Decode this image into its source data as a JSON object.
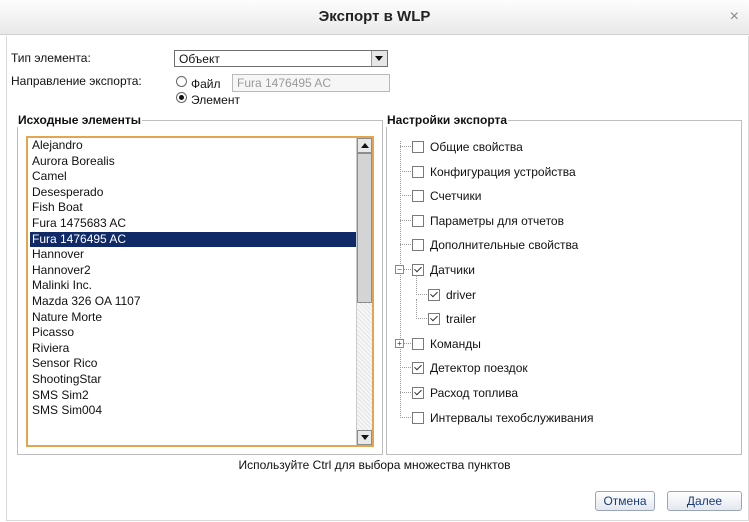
{
  "dialog": {
    "title": "Экспорт в WLP",
    "close_glyph": "×"
  },
  "form": {
    "type_label": "Тип элемента:",
    "type_value": "Объект",
    "direction_label": "Направление экспорта:",
    "direction_file_label": "Файл",
    "direction_element_label": "Элемент",
    "direction_selected": "Элемент",
    "file_field_value": "Fura 1476495 AC"
  },
  "source": {
    "legend": "Исходные элементы",
    "items": [
      "Alejandro",
      "Aurora Borealis",
      "Camel",
      "Desesperado",
      "Fish Boat",
      "Fura 1475683 AC",
      "Fura 1476495 AC",
      "Hannover",
      "Hannover2",
      "Malinki Inc.",
      "Mazda 326 OA 1107",
      "Nature Morte",
      "Picasso",
      "Riviera",
      "Sensor Rico",
      "ShootingStar",
      "SMS Sim2",
      "SMS Sim004"
    ],
    "selected_index": 6
  },
  "settings": {
    "legend": "Настройки экспорта",
    "nodes": [
      {
        "label": "Общие свойства",
        "checked": false,
        "level": 0
      },
      {
        "label": "Конфигурация устройства",
        "checked": false,
        "level": 0
      },
      {
        "label": "Счетчики",
        "checked": false,
        "level": 0
      },
      {
        "label": "Параметры для отчетов",
        "checked": false,
        "level": 0
      },
      {
        "label": "Дополнительные свойства",
        "checked": false,
        "level": 0
      },
      {
        "label": "Датчики",
        "checked": true,
        "level": 0,
        "expander": "−"
      },
      {
        "label": "driver",
        "checked": true,
        "level": 1
      },
      {
        "label": "trailer",
        "checked": true,
        "level": 1
      },
      {
        "label": "Команды",
        "checked": false,
        "level": 0,
        "expander": "+"
      },
      {
        "label": "Детектор поездок",
        "checked": true,
        "level": 0
      },
      {
        "label": "Расход топлива",
        "checked": true,
        "level": 0
      },
      {
        "label": "Интервалы техобслуживания",
        "checked": false,
        "level": 0
      }
    ]
  },
  "hint": "Используйте Ctrl для выбора множества пунктов",
  "buttons": {
    "cancel": "Отмена",
    "next": "Далее"
  },
  "colors": {
    "selection": "#0f2a67",
    "listbox_focus_border": "#e4a450",
    "button_text": "#1a3d75"
  }
}
